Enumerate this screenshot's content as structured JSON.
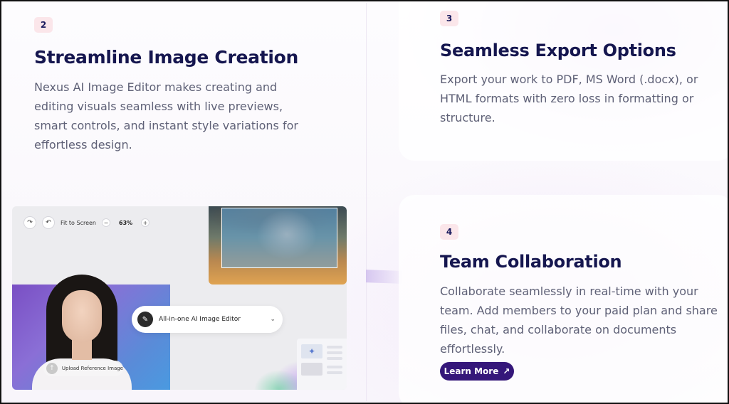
{
  "features": [
    {
      "number": "2",
      "title": "Streamline Image Creation",
      "description": "Nexus AI Image Editor makes creating and editing visuals seamless with live previews, smart controls, and instant style variations for effortless design."
    },
    {
      "number": "3",
      "title": "Seamless Export Options",
      "description": "Export your work to PDF, MS Word (.docx), or HTML formats with zero loss in formatting or structure."
    },
    {
      "number": "4",
      "title": "Team Collaboration",
      "description": "Collaborate seamlessly in real-time with your team. Add members to your paid plan and share files, chat, and collaborate on documents effortlessly.",
      "cta_label": "Learn More",
      "cta_icon": "arrow-up-right-icon"
    }
  ],
  "preview": {
    "fit_label": "Fit to Screen",
    "zoom": "63%",
    "ai_label": "All-in-one AI Image Editor",
    "upload_label": "Upload Reference Image"
  },
  "colors": {
    "title": "#15164f",
    "badge_bg": "#fbe6ea",
    "cta_bg": "#35177a",
    "body_text": "#5f6177"
  }
}
